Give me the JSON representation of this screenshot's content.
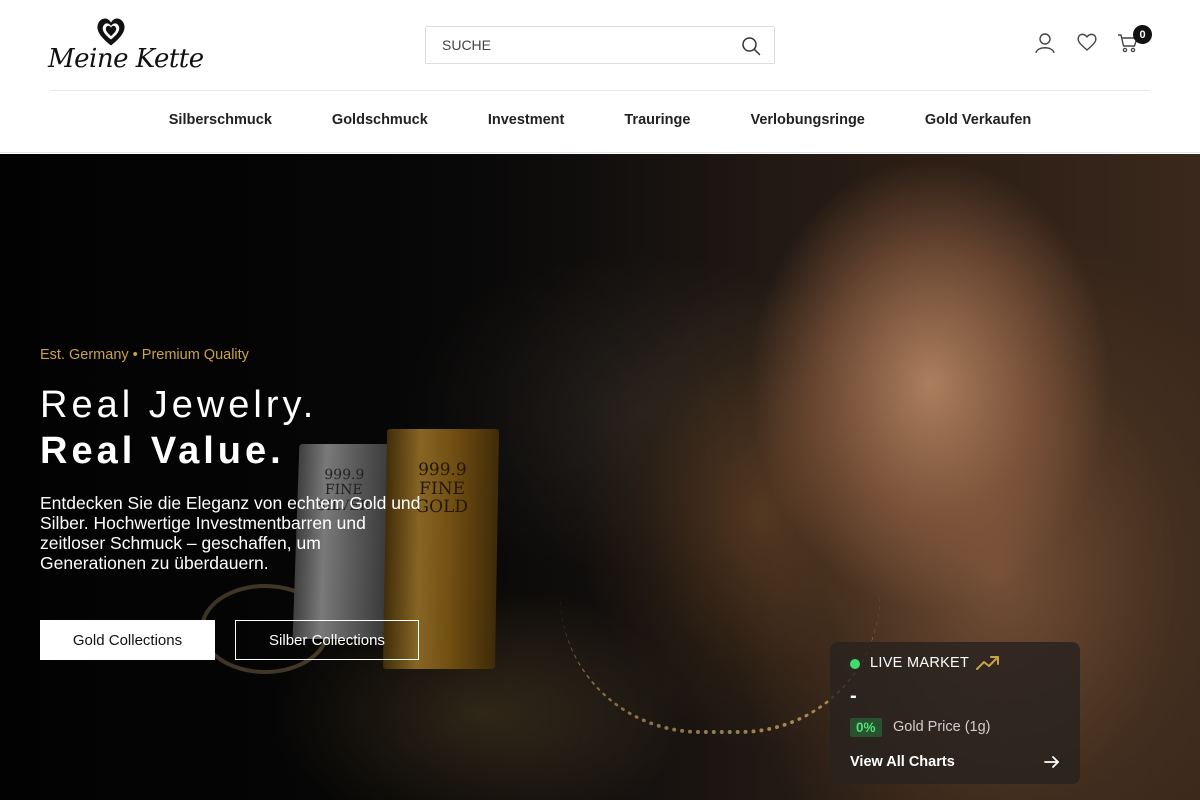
{
  "header": {
    "logo_text": "Meine Kette",
    "search": {
      "placeholder": "SUCHE",
      "value": ""
    },
    "cart_count": "0",
    "icons": [
      "user-icon",
      "heart-icon",
      "cart-icon",
      "search-icon"
    ]
  },
  "nav": {
    "items": [
      {
        "label": "Silberschmuck"
      },
      {
        "label": "Goldschmuck"
      },
      {
        "label": "Investment"
      },
      {
        "label": "Trauringe"
      },
      {
        "label": "Verlobungsringe"
      },
      {
        "label": "Gold Verkaufen"
      }
    ]
  },
  "hero": {
    "eyebrow": "Est. Germany • Premium Quality",
    "title_line1": "Real Jewelry.",
    "title_line2": "Real Value.",
    "description": "Entdecken Sie die Eleganz von echtem Gold und Silber. Hochwertige Investmentbarren und zeitloser Schmuck – geschaffen, um Generationen zu überdauern.",
    "buttons": {
      "gold": "Gold Collections",
      "silver": "Silber Collections"
    }
  },
  "market": {
    "label": "LIVE MARKET",
    "price": "-",
    "change": "0%",
    "price_label": "Gold Price (1g)",
    "link": "View All Charts",
    "colors": {
      "live": "#3ddc6b",
      "trend": "#c9a24a"
    }
  },
  "colors": {
    "accent_gold": "#c9a24a",
    "text_dark": "#222222"
  }
}
